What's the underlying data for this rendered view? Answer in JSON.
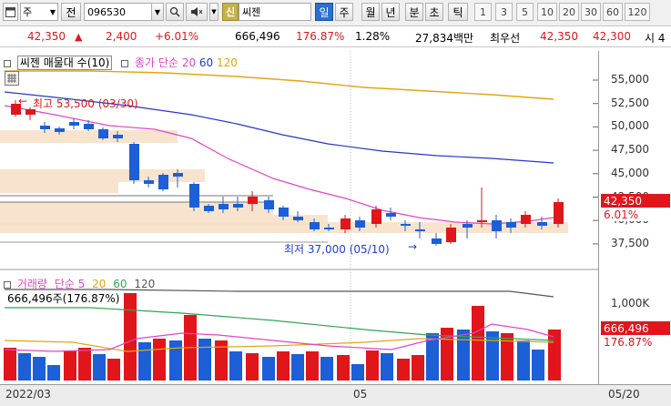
{
  "toolbar": {
    "type_label": "주",
    "prev_label": "전",
    "code": "096530",
    "badge": "신",
    "name": "씨젠",
    "periods": [
      "일",
      "주",
      "월",
      "년",
      "분",
      "초",
      "틱"
    ],
    "active_period": "일",
    "numbers": [
      "1",
      "3",
      "5",
      "10",
      "20",
      "30",
      "60",
      "120"
    ]
  },
  "quote": {
    "price": "42,350",
    "change": "2,400",
    "change_pct": "+6.01%",
    "volume": "666,496",
    "volume_ratio": "176.87%",
    "turnover": "1.28%",
    "amount": "27,834백만",
    "best_ask_label": "최우선",
    "ask": "42,350",
    "bid": "42,300",
    "tail": "시 4"
  },
  "legend": {
    "title": "씨젠 매물대 수(10)",
    "ma_label": "종가 단순",
    "ma_periods": [
      "20",
      "60",
      "120"
    ],
    "ma_colors": [
      "#e045c8",
      "#2637c8",
      "#e6a313"
    ]
  },
  "annotations": {
    "high": "최고 53,500 (03/30)",
    "low": "최저 37,000 (05/10)"
  },
  "volume_legend": {
    "title": "거래량",
    "ma_label": "단순",
    "periods": [
      "5",
      "20",
      "60",
      "120"
    ],
    "colors": [
      "#e045c8",
      "#e6a313",
      "#2fa552",
      "#555555"
    ],
    "value_text": "666,496주(176.87%)"
  },
  "price_axis": {
    "ticks": [
      "55,000",
      "52,500",
      "50,000",
      "47,500",
      "45,000",
      "42,500",
      "40,000",
      "37,500"
    ],
    "tick_values": [
      55000,
      52500,
      50000,
      47500,
      45000,
      42500,
      40000,
      37500
    ],
    "current_tag": "42,350",
    "pct_tag": "6.01%",
    "up_color": "#e0161b",
    "down_color": "#1c5fd6"
  },
  "volume_axis": {
    "tick": "1,000K",
    "current_tag": "666,496",
    "pct_tag": "176.87%"
  },
  "date_axis": {
    "labels": [
      "2022/03",
      "05",
      "05/20"
    ]
  }
}
